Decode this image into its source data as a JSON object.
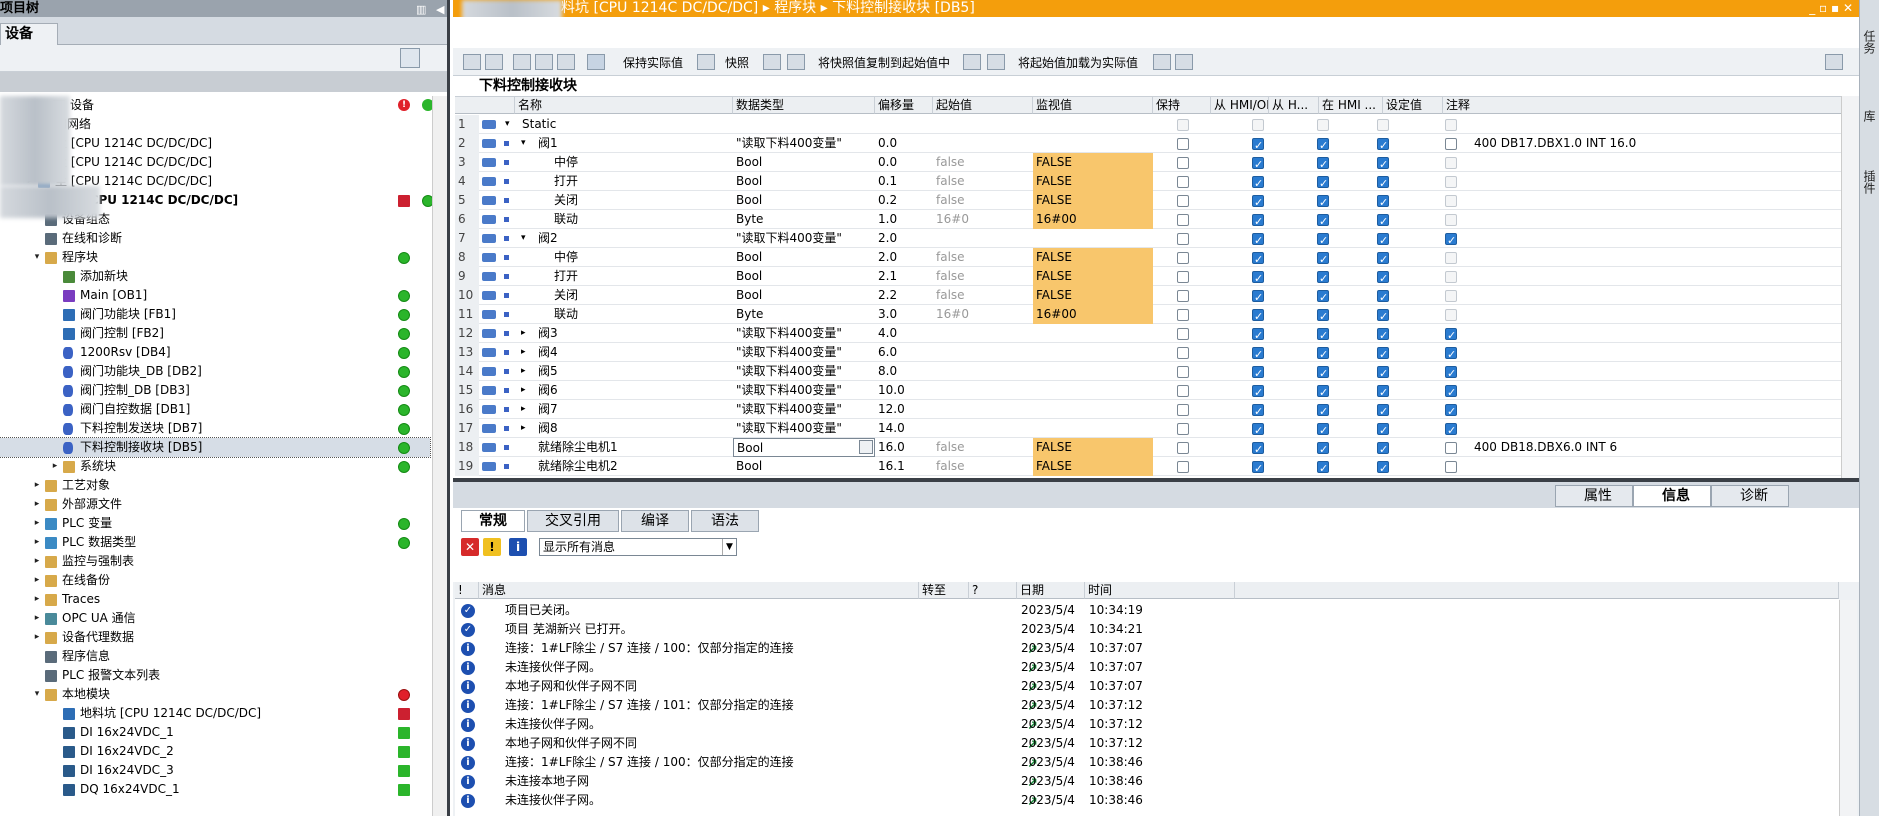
{
  "project_tree": {
    "title": "项目树",
    "tab": "设备",
    "items": [
      {
        "label": "设备",
        "indent": 70,
        "arrow": "",
        "icon": "network-icon",
        "status": ""
      },
      {
        "label": "和网络",
        "indent": 55,
        "arrow": "",
        "icon": "network-icon",
        "status": ""
      },
      {
        "label": "尘 [CPU 1214C DC/DC/DC]",
        "indent": 55,
        "arrow": "▸",
        "icon": "plc-icon",
        "status": ""
      },
      {
        "label": "尘 [CPU 1214C DC/DC/DC]",
        "indent": 55,
        "arrow": "▸",
        "icon": "plc-icon",
        "status": ""
      },
      {
        "label": "尘 [CPU 1214C DC/DC/DC]",
        "indent": 55,
        "arrow": "▸",
        "icon": "plc-icon",
        "status": ""
      },
      {
        "label": "地料坑 [CPU 1214C DC/DC/DC]",
        "indent": 44,
        "arrow": "▾",
        "icon": "plc-icon",
        "status": "green",
        "status2": "red-sq"
      },
      {
        "label": "设备组态",
        "indent": 62,
        "arrow": "",
        "icon": "device-config-icon",
        "status": ""
      },
      {
        "label": "在线和诊断",
        "indent": 62,
        "arrow": "",
        "icon": "online-diagnostics-icon",
        "status": ""
      },
      {
        "label": "程序块",
        "indent": 62,
        "arrow": "▾",
        "icon": "folder-icon",
        "status": "green"
      },
      {
        "label": "添加新块",
        "indent": 80,
        "arrow": "",
        "icon": "add-block-icon",
        "status": ""
      },
      {
        "label": "Main [OB1]",
        "indent": 80,
        "arrow": "",
        "icon": "ob-icon",
        "status": "green"
      },
      {
        "label": "阀门功能块 [FB1]",
        "indent": 80,
        "arrow": "",
        "icon": "fb-icon",
        "status": "green"
      },
      {
        "label": "阀门控制 [FB2]",
        "indent": 80,
        "arrow": "",
        "icon": "fb-icon",
        "status": "green"
      },
      {
        "label": "1200Rsv [DB4]",
        "indent": 80,
        "arrow": "",
        "icon": "db-icon",
        "status": "green"
      },
      {
        "label": "阀门功能块_DB [DB2]",
        "indent": 80,
        "arrow": "",
        "icon": "db-icon",
        "status": "green"
      },
      {
        "label": "阀门控制_DB [DB3]",
        "indent": 80,
        "arrow": "",
        "icon": "db-icon",
        "status": "green"
      },
      {
        "label": "阀门自控数据 [DB1]",
        "indent": 80,
        "arrow": "",
        "icon": "db-icon",
        "status": "green"
      },
      {
        "label": "下料控制发送块 [DB7]",
        "indent": 80,
        "arrow": "",
        "icon": "db-icon",
        "status": "green"
      },
      {
        "label": "下料控制接收块 [DB5]",
        "indent": 80,
        "arrow": "",
        "icon": "db-icon",
        "status": "green",
        "selected": true
      },
      {
        "label": "系统块",
        "indent": 80,
        "arrow": "▸",
        "icon": "folder-icon",
        "status": "green"
      },
      {
        "label": "工艺对象",
        "indent": 62,
        "arrow": "▸",
        "icon": "folder-icon",
        "status": ""
      },
      {
        "label": "外部源文件",
        "indent": 62,
        "arrow": "▸",
        "icon": "folder-icon",
        "status": ""
      },
      {
        "label": "PLC 变量",
        "indent": 62,
        "arrow": "▸",
        "icon": "plc-tags-icon",
        "status": "green"
      },
      {
        "label": "PLC 数据类型",
        "indent": 62,
        "arrow": "▸",
        "icon": "plc-types-icon",
        "status": "green"
      },
      {
        "label": "监控与强制表",
        "indent": 62,
        "arrow": "▸",
        "icon": "folder-icon",
        "status": ""
      },
      {
        "label": "在线备份",
        "indent": 62,
        "arrow": "▸",
        "icon": "folder-icon",
        "status": ""
      },
      {
        "label": "Traces",
        "indent": 62,
        "arrow": "▸",
        "icon": "folder-icon",
        "status": ""
      },
      {
        "label": "OPC UA 通信",
        "indent": 62,
        "arrow": "▸",
        "icon": "opc-icon",
        "status": ""
      },
      {
        "label": "设备代理数据",
        "indent": 62,
        "arrow": "▸",
        "icon": "folder-icon",
        "status": ""
      },
      {
        "label": "程序信息",
        "indent": 62,
        "arrow": "",
        "icon": "program-info-icon",
        "status": ""
      },
      {
        "label": "PLC 报警文本列表",
        "indent": 62,
        "arrow": "",
        "icon": "alarm-text-icon",
        "status": ""
      },
      {
        "label": "本地模块",
        "indent": 62,
        "arrow": "▾",
        "icon": "folder-icon",
        "status": "red"
      },
      {
        "label": "地料坑 [CPU 1214C DC/DC/DC]",
        "indent": 80,
        "arrow": "",
        "icon": "plc-icon",
        "status": "red-sq"
      },
      {
        "label": "DI 16x24VDC_1",
        "indent": 80,
        "arrow": "",
        "icon": "module-icon",
        "status": "green-sq"
      },
      {
        "label": "DI 16x24VDC_2",
        "indent": 80,
        "arrow": "",
        "icon": "module-icon",
        "status": "green-sq"
      },
      {
        "label": "DI 16x24VDC_3",
        "indent": 80,
        "arrow": "",
        "icon": "module-icon",
        "status": "green-sq"
      },
      {
        "label": "DQ 16x24VDC_1",
        "indent": 80,
        "arrow": "",
        "icon": "module-icon",
        "status": "green-sq"
      }
    ]
  },
  "editor": {
    "breadcrumb": [
      "料坑 [CPU 1214C DC/DC/DC]",
      "程序块",
      "下料控制接收块 [DB5]"
    ],
    "window_controls": "_ ▫ ▪ ✕",
    "toolbar": {
      "keep_actual": "保持实际值",
      "snapshot": "快照",
      "copy_snapshot": "将快照值复制到起始值中",
      "load_start": "将起始值加载为实际值"
    },
    "title": "下料控制接收块",
    "columns": [
      "名称",
      "数据类型",
      "偏移量",
      "起始值",
      "监视值",
      "保持",
      "从 HMI/OPC...",
      "从 H...",
      "在 HMI ...",
      "设定值",
      "注释"
    ],
    "rows": [
      {
        "n": "1",
        "indent": 0,
        "arrow": "▾",
        "name": "Static",
        "type": "",
        "offset": "",
        "start": "",
        "monitor": "",
        "hmi": "",
        "sp": "dis",
        "comment": ""
      },
      {
        "n": "2",
        "indent": 1,
        "arrow": "▾",
        "name": "阀1",
        "type": "\"读取下料400变量\"",
        "offset": "0.0",
        "start": "",
        "monitor": "",
        "hmi": "on",
        "sp": "off",
        "comment": "400 DB17.DBX1.0 INT 16.0"
      },
      {
        "n": "3",
        "indent": 2,
        "arrow": "",
        "name": "中停",
        "type": "Bool",
        "offset": "0.0",
        "start": "false",
        "monitor": "FALSE",
        "hmi": "on",
        "sp": "dis",
        "comment": ""
      },
      {
        "n": "4",
        "indent": 2,
        "arrow": "",
        "name": "打开",
        "type": "Bool",
        "offset": "0.1",
        "start": "false",
        "monitor": "FALSE",
        "hmi": "on",
        "sp": "dis",
        "comment": ""
      },
      {
        "n": "5",
        "indent": 2,
        "arrow": "",
        "name": "关闭",
        "type": "Bool",
        "offset": "0.2",
        "start": "false",
        "monitor": "FALSE",
        "hmi": "on",
        "sp": "dis",
        "comment": ""
      },
      {
        "n": "6",
        "indent": 2,
        "arrow": "",
        "name": "联动",
        "type": "Byte",
        "offset": "1.0",
        "start": "16#0",
        "monitor": "16#00",
        "hmi": "on",
        "sp": "dis",
        "comment": ""
      },
      {
        "n": "7",
        "indent": 1,
        "arrow": "▾",
        "name": "阀2",
        "type": "\"读取下料400变量\"",
        "offset": "2.0",
        "start": "",
        "monitor": "",
        "hmi": "on",
        "sp": "on",
        "comment": ""
      },
      {
        "n": "8",
        "indent": 2,
        "arrow": "",
        "name": "中停",
        "type": "Bool",
        "offset": "2.0",
        "start": "false",
        "monitor": "FALSE",
        "hmi": "on",
        "sp": "dis",
        "comment": ""
      },
      {
        "n": "9",
        "indent": 2,
        "arrow": "",
        "name": "打开",
        "type": "Bool",
        "offset": "2.1",
        "start": "false",
        "monitor": "FALSE",
        "hmi": "on",
        "sp": "dis",
        "comment": ""
      },
      {
        "n": "10",
        "indent": 2,
        "arrow": "",
        "name": "关闭",
        "type": "Bool",
        "offset": "2.2",
        "start": "false",
        "monitor": "FALSE",
        "hmi": "on",
        "sp": "dis",
        "comment": ""
      },
      {
        "n": "11",
        "indent": 2,
        "arrow": "",
        "name": "联动",
        "type": "Byte",
        "offset": "3.0",
        "start": "16#0",
        "monitor": "16#00",
        "hmi": "on",
        "sp": "dis",
        "comment": ""
      },
      {
        "n": "12",
        "indent": 1,
        "arrow": "▸",
        "name": "阀3",
        "type": "\"读取下料400变量\"",
        "offset": "4.0",
        "start": "",
        "monitor": "",
        "hmi": "on",
        "sp": "on",
        "comment": ""
      },
      {
        "n": "13",
        "indent": 1,
        "arrow": "▸",
        "name": "阀4",
        "type": "\"读取下料400变量\"",
        "offset": "6.0",
        "start": "",
        "monitor": "",
        "hmi": "on",
        "sp": "on",
        "comment": ""
      },
      {
        "n": "14",
        "indent": 1,
        "arrow": "▸",
        "name": "阀5",
        "type": "\"读取下料400变量\"",
        "offset": "8.0",
        "start": "",
        "monitor": "",
        "hmi": "on",
        "sp": "on",
        "comment": ""
      },
      {
        "n": "15",
        "indent": 1,
        "arrow": "▸",
        "name": "阀6",
        "type": "\"读取下料400变量\"",
        "offset": "10.0",
        "start": "",
        "monitor": "",
        "hmi": "on",
        "sp": "on",
        "comment": ""
      },
      {
        "n": "16",
        "indent": 1,
        "arrow": "▸",
        "name": "阀7",
        "type": "\"读取下料400变量\"",
        "offset": "12.0",
        "start": "",
        "monitor": "",
        "hmi": "on",
        "sp": "on",
        "comment": ""
      },
      {
        "n": "17",
        "indent": 1,
        "arrow": "▸",
        "name": "阀8",
        "type": "\"读取下料400变量\"",
        "offset": "14.0",
        "start": "",
        "monitor": "",
        "hmi": "on",
        "sp": "on",
        "comment": ""
      },
      {
        "n": "18",
        "indent": 1,
        "arrow": "",
        "name": "就绪除尘电机1",
        "type": "Bool",
        "offset": "16.0",
        "start": "false",
        "monitor": "FALSE",
        "hmi": "on",
        "sp": "off",
        "comment": "400 DB18.DBX6.0 INT 6"
      },
      {
        "n": "19",
        "indent": 1,
        "arrow": "",
        "name": "就绪除尘电机2",
        "type": "Bool",
        "offset": "16.1",
        "start": "false",
        "monitor": "FALSE",
        "hmi": "on",
        "sp": "off",
        "comment": ""
      }
    ]
  },
  "inspector": {
    "tabs": [
      "属性",
      "信息",
      "诊断"
    ],
    "subtabs": [
      "常规",
      "交叉引用",
      "编译",
      "语法"
    ],
    "filter_value": "显示所有消息",
    "columns": [
      "!",
      "消息",
      "转至",
      "?",
      "日期",
      "时间"
    ],
    "messages": [
      {
        "icon": "ok",
        "text": "项目已关闭。",
        "goto": false,
        "date": "2023/5/4",
        "time": "10:34:19"
      },
      {
        "icon": "ok",
        "text": "项目 芜湖新兴 已打开。",
        "goto": false,
        "date": "2023/5/4",
        "time": "10:34:21"
      },
      {
        "icon": "info",
        "text": "连接：1#LF除尘 / S7 连接 / 100：仅部分指定的连接",
        "goto": true,
        "date": "2023/5/4",
        "time": "10:37:07"
      },
      {
        "icon": "info",
        "text": "未连接伙伴子网。",
        "goto": true,
        "date": "2023/5/4",
        "time": "10:37:07"
      },
      {
        "icon": "info",
        "text": "本地子网和伙伴子网不同",
        "goto": true,
        "date": "2023/5/4",
        "time": "10:37:07"
      },
      {
        "icon": "info",
        "text": "连接：1#LF除尘 / S7 连接 / 101：仅部分指定的连接",
        "goto": true,
        "date": "2023/5/4",
        "time": "10:37:12"
      },
      {
        "icon": "info",
        "text": "未连接伙伴子网。",
        "goto": true,
        "date": "2023/5/4",
        "time": "10:37:12"
      },
      {
        "icon": "info",
        "text": "本地子网和伙伴子网不同",
        "goto": true,
        "date": "2023/5/4",
        "time": "10:37:12"
      },
      {
        "icon": "info",
        "text": "连接：1#LF除尘 / S7 连接 / 100：仅部分指定的连接",
        "goto": true,
        "date": "2023/5/4",
        "time": "10:38:46"
      },
      {
        "icon": "info",
        "text": "未连接本地子网",
        "goto": true,
        "date": "2023/5/4",
        "time": "10:38:46"
      },
      {
        "icon": "info",
        "text": "未连接伙伴子网。",
        "goto": true,
        "date": "2023/5/4",
        "time": "10:38:46"
      }
    ]
  },
  "task_bar": [
    "任务",
    "库",
    "插件"
  ],
  "colors": {
    "title_orange": "#f49e0c",
    "monitor_bg": "#f8c66c",
    "checkbox_blue": "#2a7bd0",
    "ok_green": "#2bb52b",
    "error_red": "#e0202a"
  }
}
